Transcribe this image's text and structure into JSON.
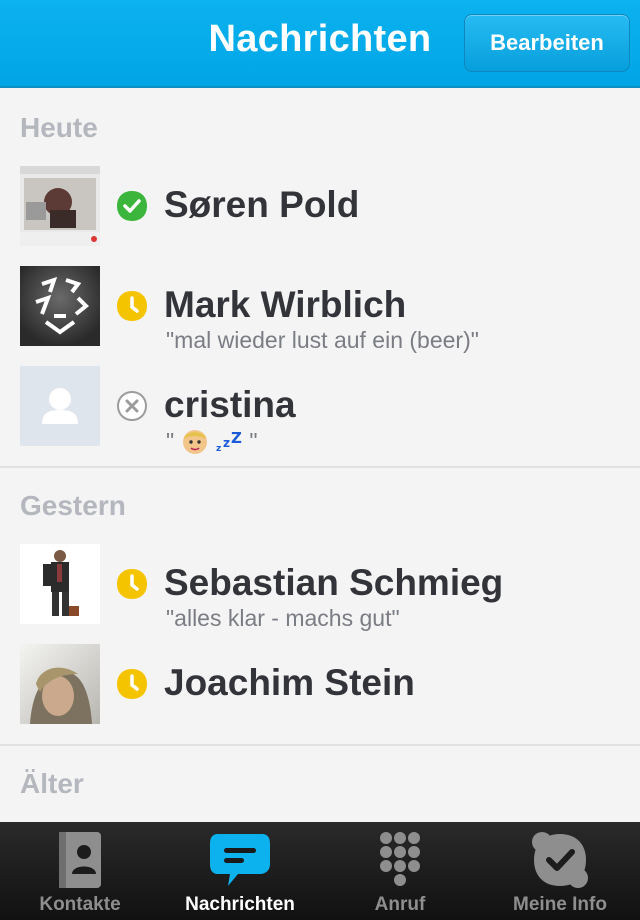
{
  "navbar": {
    "title": "Nachrichten",
    "edit_label": "Bearbeiten"
  },
  "sections": [
    {
      "header": "Heute"
    },
    {
      "header": "Gestern"
    },
    {
      "header": "Älter"
    }
  ],
  "conversations": [
    {
      "name": "Søren Pold",
      "message": "",
      "status": "online"
    },
    {
      "name": "Mark Wirblich",
      "message": "\"mal wieder lust auf ein  (beer)\"",
      "status": "away"
    },
    {
      "name": "cristina",
      "message": "\"",
      "message_end": "\"",
      "status": "offline"
    },
    {
      "name": "Sebastian Schmieg",
      "message": "\"alles klar - machs gut\"",
      "status": "away"
    },
    {
      "name": "Joachim Stein",
      "message": "",
      "status": "away"
    }
  ],
  "tabs": [
    {
      "label": "Kontakte",
      "icon": "contacts-icon"
    },
    {
      "label": "Nachrichten",
      "icon": "chat-bubble-icon"
    },
    {
      "label": "Anruf",
      "icon": "dialpad-icon"
    },
    {
      "label": "Meine Info",
      "icon": "skype-check-icon"
    }
  ],
  "colors": {
    "accent": "#00a5e6",
    "online": "#3bb53b",
    "away": "#f5c400",
    "offline": "#9c9c9c"
  }
}
